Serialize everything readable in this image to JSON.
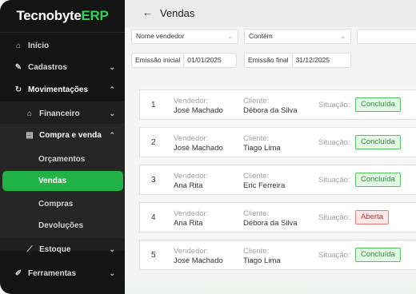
{
  "app": {
    "logo_a": "Tecnobyte",
    "logo_b": "ERP"
  },
  "sidebar": {
    "items": [
      {
        "label": "Início",
        "icon": "home-icon"
      },
      {
        "label": "Cadastros",
        "icon": "pencil-icon"
      },
      {
        "label": "Movimentações",
        "icon": "sync-icon"
      },
      {
        "label": "Financeiro",
        "icon": "bank-icon"
      },
      {
        "label": "Compra e venda",
        "icon": "receipt-icon"
      },
      {
        "label": "Orçamentos"
      },
      {
        "label": "Vendas"
      },
      {
        "label": "Compras"
      },
      {
        "label": "Devoluções"
      },
      {
        "label": "Estoque",
        "icon": "chart-icon"
      },
      {
        "label": "Ferramentas",
        "icon": "wrench-icon"
      }
    ]
  },
  "header": {
    "back": "←",
    "title": "Vendas"
  },
  "filters": {
    "field": "Nome vendedor",
    "operator": "Contém",
    "search": "",
    "start_label": "Emissão inicial",
    "start_value": "01/01/2025",
    "end_label": "Emissão final",
    "end_value": "31/12/2025"
  },
  "labels": {
    "seller": "Vendedor:",
    "client": "Cliente:",
    "status": "Situação:"
  },
  "sales": [
    {
      "num": "1",
      "seller": "José Machado",
      "client": "Débora da Silva",
      "status": "Concluída",
      "kind": "ok"
    },
    {
      "num": "2",
      "seller": "José Machado",
      "client": "Tiago Lima",
      "status": "Concluída",
      "kind": "ok"
    },
    {
      "num": "3",
      "seller": "Ana Rita",
      "client": "Eric Ferreira",
      "status": "Concluída",
      "kind": "ok"
    },
    {
      "num": "4",
      "seller": "Ana Rita",
      "client": "Débora da Silva",
      "status": "Aberta",
      "kind": "open"
    },
    {
      "num": "5",
      "seller": "José Machado",
      "client": "Tiago Lima",
      "status": "Concluída",
      "kind": "ok"
    }
  ],
  "colors": {
    "accent": "#22b347",
    "sidebar": "#141414"
  }
}
